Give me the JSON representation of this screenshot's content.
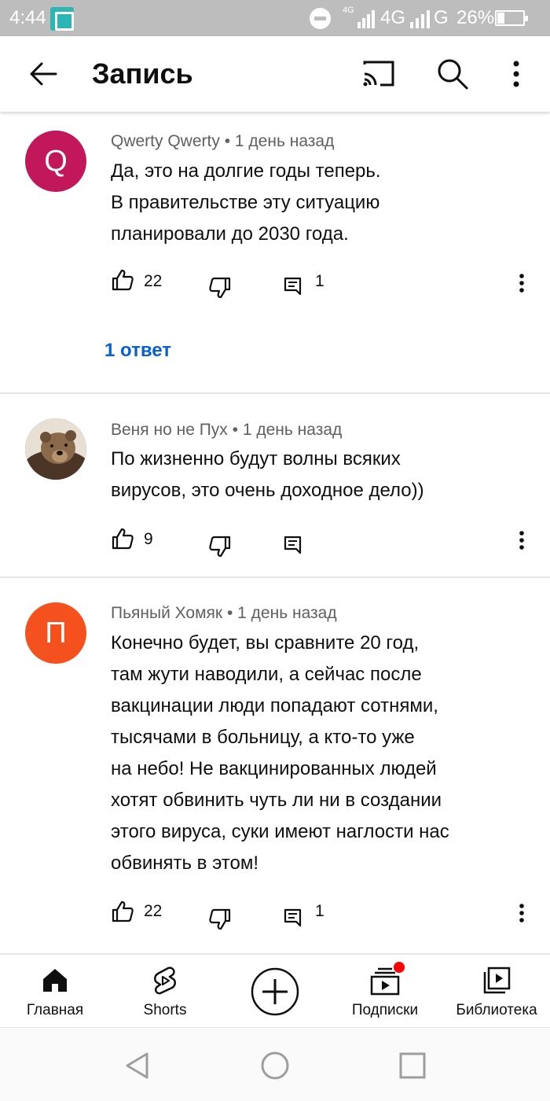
{
  "status_bar": {
    "time": "4:44",
    "network_small": "4G",
    "network1": "4G",
    "network2": "G",
    "battery": "26%"
  },
  "app_bar": {
    "title": "Запись",
    "icons": [
      "arrow-left-icon",
      "cast-icon",
      "search-icon",
      "more-vert-icon"
    ]
  },
  "comments": [
    {
      "avatar_letter": "Q",
      "avatar_color": "#c2185b",
      "author": "Qwerty Qwerty",
      "time": "1 день назад",
      "lines": [
        "Да, это на долгие годы теперь.",
        "В правительстве эту ситуацию",
        "планировали до 2030 года."
      ],
      "likes": "22",
      "replies_count": "1",
      "replies_link": "1 ответ"
    },
    {
      "avatar_letter": "",
      "avatar_color": "#6d5a45",
      "author": "Веня но не Пух",
      "time": "1 день назад",
      "lines": [
        "По жизненно будут волны всяких",
        "вирусов, это очень доходное дело))"
      ],
      "likes": "9",
      "replies_count": ""
    },
    {
      "avatar_letter": "П",
      "avatar_color": "#f4511e",
      "author": "Пьяный Хомяк",
      "time": "1 день назад",
      "lines": [
        "Конечно будет, вы сравните 20 год,",
        "там жути наводили, а сейчас после",
        "вакцинации люди попадают сотнями,",
        "тысячами в больницу, а кто-то уже",
        "на небо! Не вакцинированных людей",
        "хотят обвинить чуть ли ни в создании",
        "этого вируса, суки имеют наглости нас",
        "обвинять в этом!"
      ],
      "likes": "22",
      "replies_count": "1"
    }
  ],
  "separator": "•",
  "bottom_nav": [
    {
      "label": "Главная",
      "icon": "home-icon"
    },
    {
      "label": "Shorts",
      "icon": "shorts-icon"
    },
    {
      "label": "",
      "icon": "create-plus-icon"
    },
    {
      "label": "Подписки",
      "icon": "subscriptions-icon"
    },
    {
      "label": "Библиотека",
      "icon": "library-icon"
    }
  ],
  "colors": {
    "link": "#065fd4",
    "meta_text": "#606060",
    "notification_dot": "#ff0000"
  }
}
